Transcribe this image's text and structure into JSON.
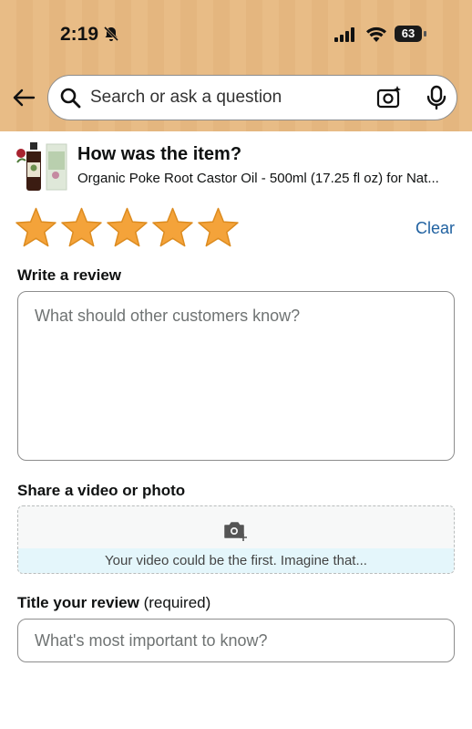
{
  "status_bar": {
    "time": "2:19",
    "battery": "63"
  },
  "search": {
    "placeholder": "Search or ask a question"
  },
  "product": {
    "heading": "How was the item?",
    "name": "Organic Poke Root Castor Oil - 500ml (17.25 fl oz) for Nat..."
  },
  "rating": {
    "stars_filled": 5,
    "stars_total": 5,
    "clear_label": "Clear"
  },
  "review": {
    "label": "Write a review",
    "placeholder": "What should other customers know?"
  },
  "media": {
    "label": "Share a video or photo",
    "prompt": "Your video could be the first. Imagine that..."
  },
  "title_field": {
    "label": "Title your review",
    "required_note": "(required)",
    "placeholder": "What's most important to know?"
  },
  "colors": {
    "header_bg": "#e8bc86",
    "star": "#f4a33a",
    "link": "#2162a1",
    "media_strip": "#e4f6fb"
  }
}
